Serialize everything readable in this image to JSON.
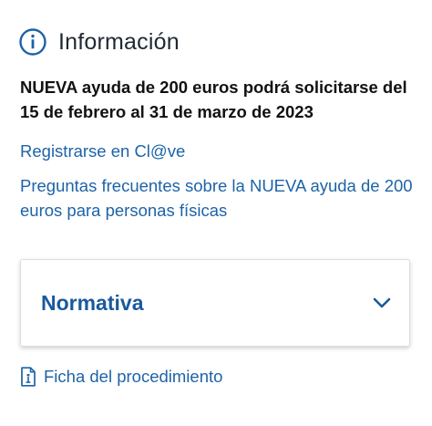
{
  "header": {
    "icon": "info-circle-icon",
    "title": "Información"
  },
  "headline": "NUEVA ayuda de 200 euros podrá solicitarse del 15 de febrero al 31 de marzo de 2023",
  "links": {
    "clave": "Registrarse en Cl@ve",
    "faq": "Preguntas frecuentes sobre la NUEVA ayuda de 200 euros para personas físicas"
  },
  "accordion": {
    "title": "Normativa",
    "icon": "chevron-down-icon",
    "expanded": false
  },
  "ficha": {
    "icon": "document-icon",
    "label": "Ficha del procedimiento"
  },
  "colors": {
    "link": "#1d63a8",
    "accent": "#1a5a9c",
    "text": "#111111"
  }
}
